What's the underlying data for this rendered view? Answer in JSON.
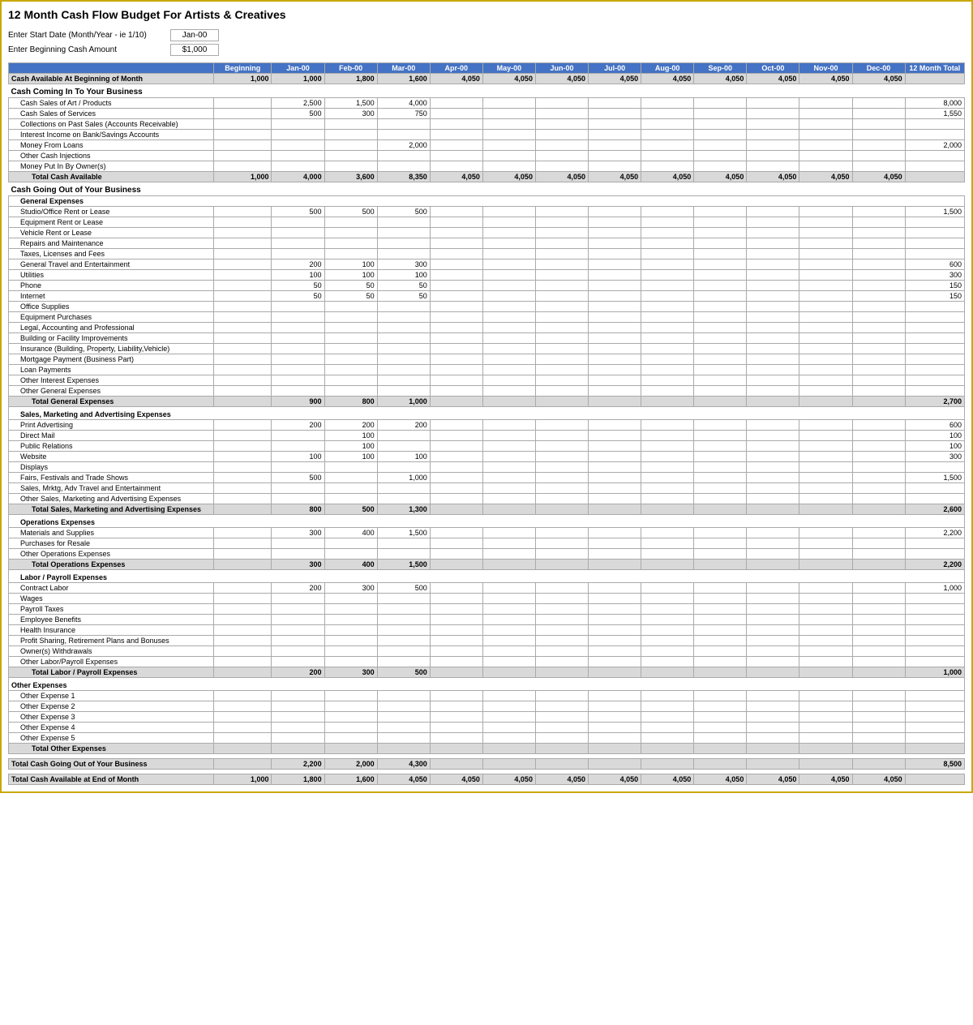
{
  "title": "12 Month Cash Flow Budget For Artists & Creatives",
  "setup": {
    "start_date_label": "Enter Start Date (Month/Year - ie 1/10)",
    "start_date_value": "Jan-00",
    "begin_cash_label": "Enter Beginning Cash Amount",
    "begin_cash_value": "$1,000"
  },
  "headers": {
    "label": "",
    "beginning": "Beginning",
    "months": [
      "Jan-00",
      "Feb-00",
      "Mar-00",
      "Apr-00",
      "May-00",
      "Jun-00",
      "Jul-00",
      "Aug-00",
      "Sep-00",
      "Oct-00",
      "Nov-00",
      "Dec-00"
    ],
    "total": "12 Month Total"
  },
  "cash_available_begin": {
    "label": "Cash Available At Beginning of Month",
    "values": {
      "beginning": "1,000",
      "jan": "1,000",
      "feb": "1,800",
      "mar": "1,600",
      "apr": "4,050",
      "may": "4,050",
      "jun": "4,050",
      "jul": "4,050",
      "aug": "4,050",
      "sep": "4,050",
      "oct": "4,050",
      "nov": "4,050",
      "dec": "4,050",
      "total": ""
    }
  },
  "cash_in": {
    "section_label": "Cash Coming In To Your Business",
    "items": [
      {
        "label": "Cash Sales of Art / Products",
        "indent": 1,
        "values": {
          "jan": "2,500",
          "feb": "1,500",
          "mar": "4,000",
          "total": "8,000"
        }
      },
      {
        "label": "Cash Sales of Services",
        "indent": 1,
        "values": {
          "jan": "500",
          "feb": "300",
          "mar": "750",
          "total": "1,550"
        }
      },
      {
        "label": "Collections on Past Sales (Accounts Receivable)",
        "indent": 1,
        "values": {}
      },
      {
        "label": "Interest Income on Bank/Savings Accounts",
        "indent": 1,
        "values": {}
      },
      {
        "label": "Money From Loans",
        "indent": 1,
        "values": {
          "mar": "2,000",
          "total": "2,000"
        }
      },
      {
        "label": "Other Cash Injections",
        "indent": 1,
        "values": {}
      },
      {
        "label": "Money Put In By Owner(s)",
        "indent": 1,
        "values": {}
      }
    ],
    "total": {
      "label": "Total Cash Available",
      "values": {
        "beginning": "1,000",
        "jan": "4,000",
        "feb": "3,600",
        "mar": "8,350",
        "apr": "4,050",
        "may": "4,050",
        "jun": "4,050",
        "jul": "4,050",
        "aug": "4,050",
        "sep": "4,050",
        "oct": "4,050",
        "nov": "4,050",
        "dec": "4,050",
        "total": ""
      }
    }
  },
  "cash_out": {
    "section_label": "Cash Going Out of Your Business",
    "general": {
      "subsection_label": "General Expenses",
      "items": [
        {
          "label": "Studio/Office Rent or Lease",
          "indent": 1,
          "values": {
            "jan": "500",
            "feb": "500",
            "mar": "500",
            "total": "1,500"
          }
        },
        {
          "label": "Equipment Rent or Lease",
          "indent": 1,
          "values": {}
        },
        {
          "label": "Vehicle Rent or Lease",
          "indent": 1,
          "values": {}
        },
        {
          "label": "Repairs and Maintenance",
          "indent": 1,
          "values": {}
        },
        {
          "label": "Taxes, Licenses and Fees",
          "indent": 1,
          "values": {}
        },
        {
          "label": "General Travel and Entertainment",
          "indent": 1,
          "values": {
            "jan": "200",
            "feb": "100",
            "mar": "300",
            "total": "600"
          }
        },
        {
          "label": "Utilities",
          "indent": 1,
          "values": {
            "jan": "100",
            "feb": "100",
            "mar": "100",
            "total": "300"
          }
        },
        {
          "label": "Phone",
          "indent": 1,
          "values": {
            "jan": "50",
            "feb": "50",
            "mar": "50",
            "total": "150"
          }
        },
        {
          "label": "Internet",
          "indent": 1,
          "values": {
            "jan": "50",
            "feb": "50",
            "mar": "50",
            "total": "150"
          }
        },
        {
          "label": "Office Supplies",
          "indent": 1,
          "values": {}
        },
        {
          "label": "Equipment Purchases",
          "indent": 1,
          "values": {}
        },
        {
          "label": "Legal, Accounting and Professional",
          "indent": 1,
          "values": {}
        },
        {
          "label": "Building or Facility Improvements",
          "indent": 1,
          "values": {}
        },
        {
          "label": "Insurance (Building, Property, Liability,Vehicle)",
          "indent": 1,
          "values": {}
        },
        {
          "label": "Mortgage Payment (Business Part)",
          "indent": 1,
          "values": {}
        },
        {
          "label": "Loan Payments",
          "indent": 1,
          "values": {}
        },
        {
          "label": "Other Interest Expenses",
          "indent": 1,
          "values": {}
        },
        {
          "label": "Other General Expenses",
          "indent": 1,
          "values": {}
        }
      ],
      "total": {
        "label": "Total General Expenses",
        "values": {
          "jan": "900",
          "feb": "800",
          "mar": "1,000",
          "total": "2,700"
        }
      }
    },
    "sales_mktg": {
      "subsection_label": "Sales, Marketing and Advertising Expenses",
      "items": [
        {
          "label": "Print Advertising",
          "indent": 1,
          "values": {
            "jan": "200",
            "feb": "200",
            "mar": "200",
            "total": "600"
          }
        },
        {
          "label": "Direct Mail",
          "indent": 1,
          "values": {
            "feb": "100",
            "total": "100"
          }
        },
        {
          "label": "Public Relations",
          "indent": 1,
          "values": {
            "feb": "100",
            "total": "100"
          }
        },
        {
          "label": "Website",
          "indent": 1,
          "values": {
            "jan": "100",
            "feb": "100",
            "mar": "100",
            "total": "300"
          }
        },
        {
          "label": "Displays",
          "indent": 1,
          "values": {}
        },
        {
          "label": "Fairs, Festivals and Trade Shows",
          "indent": 1,
          "values": {
            "jan": "500",
            "mar": "1,000",
            "total": "1,500"
          }
        },
        {
          "label": "Sales, Mrktg, Adv Travel and Entertainment",
          "indent": 1,
          "values": {}
        },
        {
          "label": "Other Sales, Marketing and Advertising Expenses",
          "indent": 1,
          "values": {}
        }
      ],
      "total": {
        "label": "Total Sales, Marketing and Advertising Expenses",
        "values": {
          "jan": "800",
          "feb": "500",
          "mar": "1,300",
          "total": "2,600"
        }
      }
    },
    "operations": {
      "subsection_label": "Operations Expenses",
      "items": [
        {
          "label": "Materials and Supplies",
          "indent": 1,
          "values": {
            "jan": "300",
            "feb": "400",
            "mar": "1,500",
            "total": "2,200"
          }
        },
        {
          "label": "Purchases for Resale",
          "indent": 1,
          "values": {}
        },
        {
          "label": "Other Operations Expenses",
          "indent": 1,
          "values": {}
        }
      ],
      "total": {
        "label": "Total Operations Expenses",
        "values": {
          "jan": "300",
          "feb": "400",
          "mar": "1,500",
          "total": "2,200"
        }
      }
    },
    "labor": {
      "subsection_label": "Labor / Payroll Expenses",
      "items": [
        {
          "label": "Contract Labor",
          "indent": 1,
          "values": {
            "jan": "200",
            "feb": "300",
            "mar": "500",
            "total": "1,000"
          }
        },
        {
          "label": "Wages",
          "indent": 1,
          "values": {}
        },
        {
          "label": "Payroll Taxes",
          "indent": 1,
          "values": {}
        },
        {
          "label": "Employee Benefits",
          "indent": 1,
          "values": {}
        },
        {
          "label": "Health Insurance",
          "indent": 1,
          "values": {}
        },
        {
          "label": "Profit Sharing, Retirement Plans and Bonuses",
          "indent": 1,
          "values": {}
        },
        {
          "label": "Owner(s) Withdrawals",
          "indent": 1,
          "values": {}
        },
        {
          "label": "Other Labor/Payroll Expenses",
          "indent": 1,
          "values": {}
        }
      ],
      "total": {
        "label": "Total Labor / Payroll Expenses",
        "values": {
          "jan": "200",
          "feb": "300",
          "mar": "500",
          "total": "1,000"
        }
      }
    },
    "other": {
      "subsection_label": "Other Expenses",
      "items": [
        {
          "label": "Other Expense 1",
          "indent": 1,
          "values": {}
        },
        {
          "label": "Other Expense 2",
          "indent": 1,
          "values": {}
        },
        {
          "label": "Other Expense 3",
          "indent": 1,
          "values": {}
        },
        {
          "label": "Other Expense 4",
          "indent": 1,
          "values": {}
        },
        {
          "label": "Other Expense 5",
          "indent": 1,
          "values": {}
        }
      ],
      "total": {
        "label": "Total Other Expenses",
        "values": {}
      }
    }
  },
  "total_cash_out": {
    "label": "Total Cash Going Out of Your Business",
    "values": {
      "jan": "2,200",
      "feb": "2,000",
      "mar": "4,300",
      "total": "8,500"
    }
  },
  "cash_end": {
    "label": "Total Cash Available at End of Month",
    "values": {
      "beginning": "1,000",
      "jan": "1,800",
      "feb": "1,600",
      "mar": "4,050",
      "apr": "4,050",
      "may": "4,050",
      "jun": "4,050",
      "jul": "4,050",
      "aug": "4,050",
      "sep": "4,050",
      "oct": "4,050",
      "nov": "4,050",
      "dec": "4,050",
      "total": ""
    }
  }
}
